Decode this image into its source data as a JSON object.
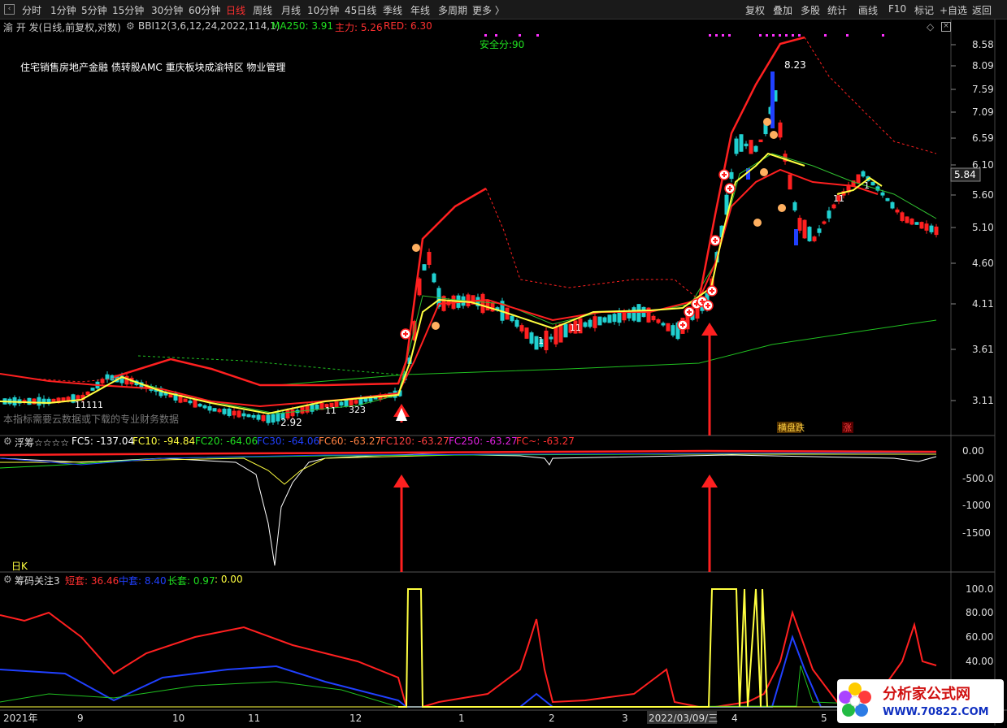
{
  "toolbar": {
    "periods": [
      "分时",
      "1分钟",
      "5分钟",
      "15分钟",
      "30分钟",
      "60分钟",
      "日线",
      "周线",
      "月线",
      "10分钟",
      "45日线",
      "季线",
      "年线",
      "多周期",
      "更多 〉"
    ],
    "active_period": "日线",
    "right_buttons": [
      "复权",
      "叠加",
      "多股",
      "统计",
      "画线",
      "F10",
      "标记",
      "+自选",
      "返回"
    ]
  },
  "main_chart": {
    "stock_label": "渝 开 发(日线,前复权,对数)",
    "indicator_name": "BBI12(3,6,12,24,2022,114,1)",
    "ma250": "MA250: 3.91",
    "zhuli": "主力: 5.26",
    "red": "RED: 6.30",
    "safety": "安全分:90",
    "concepts": "住宅销售房地产金融 债转股AMC 重庆板块成渝特区 物业管理",
    "footnote": "本指标需要云数据或下载的专业财务数据",
    "high_label": "8.23",
    "low_label": "2.92",
    "current_price": "5.84",
    "y_ticks": [
      "8.58",
      "8.09",
      "7.59",
      "7.09",
      "6.59",
      "6.10",
      "5.60",
      "5.10",
      "4.60",
      "4.11",
      "3.61",
      "3.11"
    ],
    "tags": [
      "横盘跌",
      "涨"
    ],
    "numbers": [
      "11111",
      "11",
      "323",
      "11",
      "1",
      "1",
      "11"
    ]
  },
  "indicator1": {
    "name": "浮筹☆☆☆☆",
    "fc5": "FC5: -137.04",
    "fc10": "FC10: -94.84",
    "fc20": "FC20: -64.06",
    "fc30": "FC30: -64.06",
    "fc60": "FC60: -63.27",
    "fc120": "FC120: -63.27",
    "fc250": "FC250: -63.27",
    "fcall": "FC~: -63.27",
    "y_ticks": [
      "0.00",
      "-500.0",
      "-1000",
      "-1500"
    ],
    "period_tag": "日K"
  },
  "indicator2": {
    "name": "筹码关注3",
    "short": "短套: 36.46",
    "mid": "中套: 8.40",
    "long": "长套: 0.97",
    "extra": ": 0.00",
    "y_ticks": [
      "100.0",
      "80.00",
      "60.00",
      "40.00"
    ]
  },
  "x_axis": {
    "labels": [
      "2021年",
      "9",
      "10",
      "11",
      "12",
      "1",
      "2",
      "3",
      "2022/03/09/三",
      "4",
      "5"
    ]
  },
  "watermark": {
    "title": "分析家公式网",
    "url": "WWW.70822.COM"
  },
  "colors": {
    "up": "#ff2020",
    "down": "#20d0d0",
    "bbi": "#ffff40",
    "ma250": "#20c020",
    "red_line": "#ff2020",
    "arrow": "#ff2020"
  }
}
